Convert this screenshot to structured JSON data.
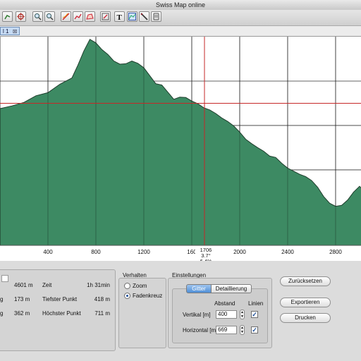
{
  "window": {
    "title": "Swiss Map online"
  },
  "toolbar": {
    "items": [
      "route-icon",
      "export-icon",
      "marker-icon",
      "zoom-in-icon",
      "zoom-out-icon",
      "draw-line-icon",
      "draw-path-icon",
      "draw-area-icon",
      "edit-icon",
      "text-icon",
      "profile-icon",
      "measure-icon",
      "print-icon"
    ]
  },
  "tab": {
    "label": "l 1"
  },
  "chart_data": {
    "type": "area",
    "color": "#3d8a63",
    "x_ticks": [
      "400",
      "800",
      "1200",
      "160",
      "2000",
      "2400",
      "2800",
      "32"
    ],
    "x_range": [
      0,
      3200
    ],
    "x": [
      0,
      100,
      200,
      300,
      400,
      500,
      600,
      650,
      700,
      750,
      800,
      850,
      900,
      950,
      1000,
      1050,
      1100,
      1150,
      1200,
      1250,
      1300,
      1350,
      1400,
      1450,
      1500,
      1550,
      1600,
      1650,
      1700,
      1750,
      1800,
      1850,
      1900,
      1950,
      2000,
      2050,
      2100,
      2150,
      2200,
      2250,
      2300,
      2350,
      2400,
      2450,
      2500,
      2550,
      2600,
      2650,
      2700,
      2750,
      2800,
      2850,
      2900,
      2950,
      3000,
      3050,
      3100,
      3150,
      3200
    ],
    "y": [
      638,
      644,
      652,
      667,
      674,
      693,
      707,
      736,
      768,
      794,
      786,
      771,
      760,
      745,
      738,
      739,
      745,
      740,
      730,
      712,
      694,
      691,
      675,
      659,
      664,
      663,
      655,
      649,
      640,
      635,
      627,
      617,
      609,
      599,
      585,
      569,
      559,
      550,
      542,
      531,
      528,
      515,
      504,
      497,
      490,
      485,
      476,
      461,
      440,
      425,
      418,
      420,
      432,
      450,
      463,
      449,
      430,
      420,
      419
    ],
    "crosshair": {
      "distance": "1706",
      "gradient": "3.7°",
      "percent": "6.4%"
    }
  },
  "stats": {
    "rows": [
      {
        "left_label": "",
        "left_value": "4601 m",
        "right_label": "Zeit",
        "right_value": "1h 31min"
      },
      {
        "left_label": "g",
        "left_value": "173 m",
        "right_label": "Tiefster Punkt",
        "right_value": "418 m"
      },
      {
        "left_label": "g",
        "left_value": "362 m",
        "right_label": "Höchster Punkt",
        "right_value": "711 m"
      }
    ]
  },
  "verhalten": {
    "title": "Verhalten",
    "options": [
      "Zoom",
      "Fadenkreuz"
    ],
    "selected": "Fadenkreuz"
  },
  "einstellungen": {
    "title": "Einstellungen",
    "tabs": [
      "Gitter",
      "Detaillierung"
    ],
    "active_tab": "Gitter",
    "col_abstand": "Abstand",
    "col_linien": "Linien",
    "vertikal_label": "Vertikal [m]",
    "vertikal_value": "400",
    "horizontal_label": "Horizontal [m]",
    "horizontal_value": "669"
  },
  "actions": {
    "reset": "Zurücksetzen",
    "export": "Exportieren",
    "print": "Drucken"
  }
}
